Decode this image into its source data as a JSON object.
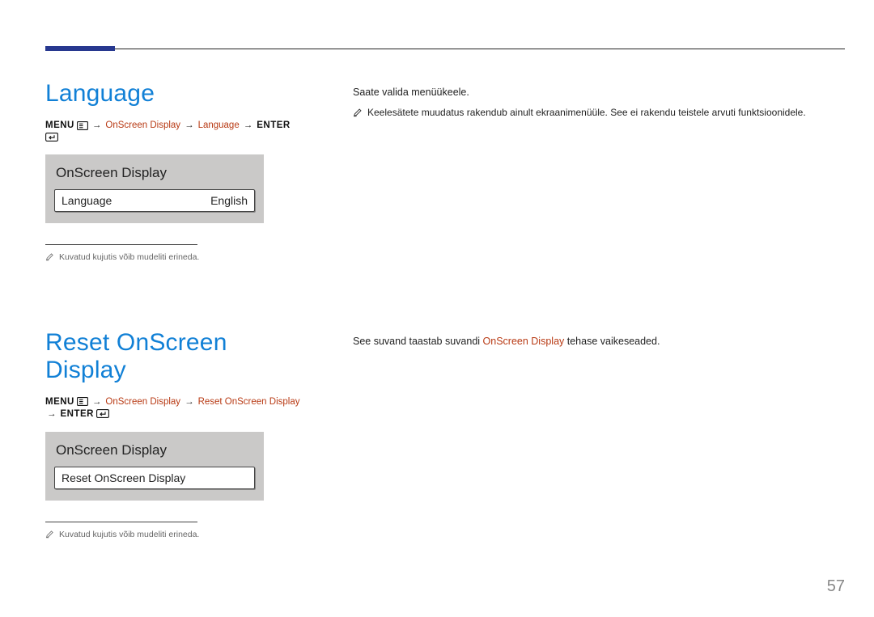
{
  "page_number": "57",
  "section1": {
    "heading": "Language",
    "nav": {
      "menu_label": "MENU",
      "path1": "OnScreen Display",
      "path2": "Language",
      "enter_label": "ENTER"
    },
    "panel": {
      "title": "OnScreen Display",
      "row_label": "Language",
      "row_value": "English"
    },
    "left_note": "Kuvatud kujutis võib mudeliti erineda.",
    "right_line": "Saate valida menüükeele.",
    "right_note": "Keelesätete muudatus rakendub ainult ekraanimenüüle. See ei rakendu teistele arvuti funktsioonidele."
  },
  "section2": {
    "heading": "Reset OnScreen Display",
    "nav": {
      "menu_label": "MENU",
      "path1": "OnScreen Display",
      "path2": "Reset OnScreen Display",
      "enter_label": "ENTER"
    },
    "panel": {
      "title": "OnScreen Display",
      "row_label": "Reset OnScreen Display"
    },
    "left_note": "Kuvatud kujutis võib mudeliti erineda.",
    "right_prefix": "See suvand taastab suvandi ",
    "right_inline": "OnScreen Display",
    "right_suffix": " tehase vaikeseaded."
  }
}
